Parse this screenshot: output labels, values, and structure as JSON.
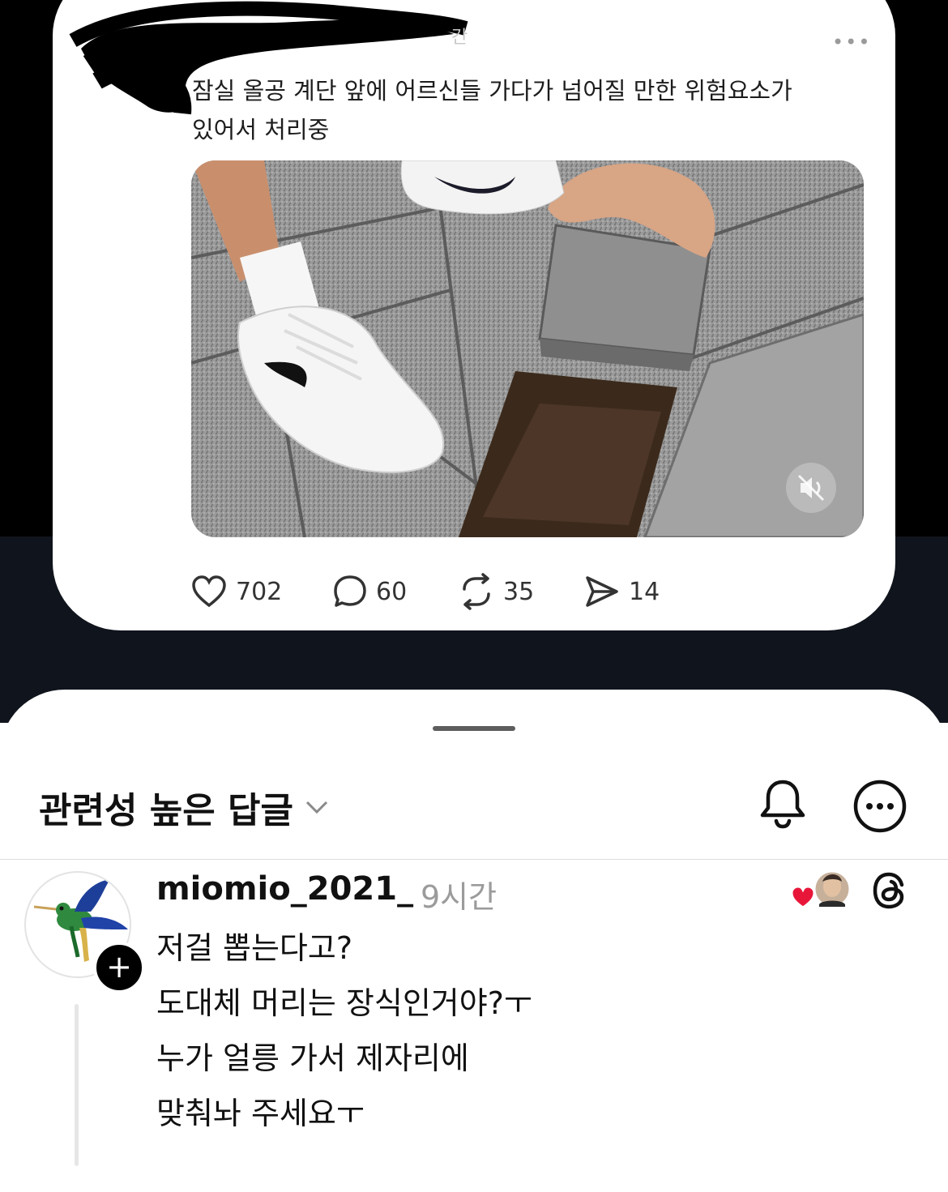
{
  "post": {
    "time_ghost": "간",
    "more": "•••",
    "text_lines": [
      "잠실 올공 계단 앞에 어르신들 가다가 넘어질 만한 위험요소가",
      "있어서 처리중"
    ],
    "stats": {
      "likes": "702",
      "comments": "60",
      "reposts": "35",
      "shares": "14"
    }
  },
  "sheet": {
    "title": "관련성 높은 답글"
  },
  "reply": {
    "username": "miomio_2021_",
    "time": "9시간",
    "follow_symbol": "+",
    "lines": [
      "저걸 뽑는다고?",
      "도대체 머리는 장식인거야?ㅜ",
      "누가 얼릉 가서 제자리에",
      "맞춰놔 주세요ㅜ"
    ]
  },
  "colors": {
    "background_dark": "#000000",
    "like_heart": "#e8173a"
  },
  "icons": [
    "heart-icon",
    "comment-icon",
    "repost-icon",
    "share-icon",
    "mute-icon",
    "chevron-down-icon",
    "bell-icon",
    "more-icon",
    "threads-icon"
  ]
}
